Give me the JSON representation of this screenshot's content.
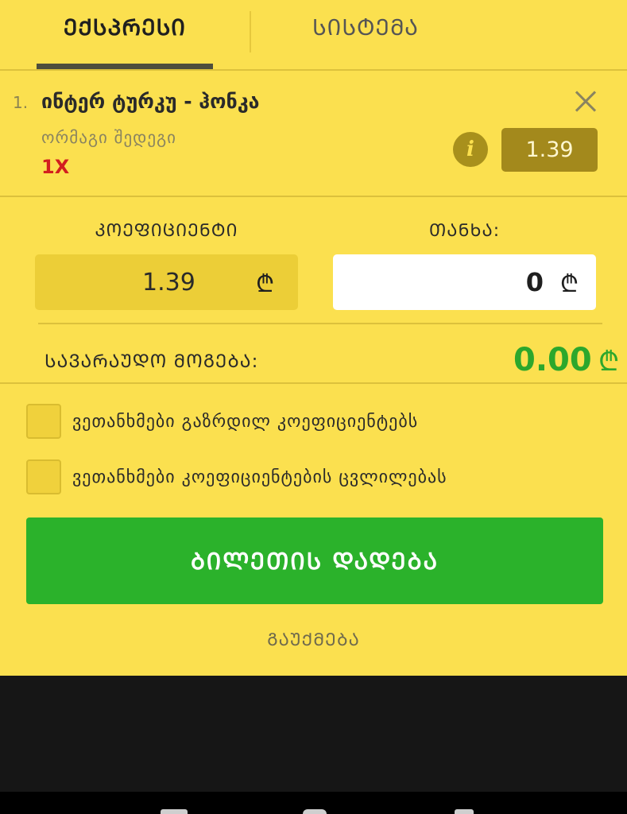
{
  "tabs": {
    "active": "ᲔᲥᲡᲞᲠᲔᲡᲘ",
    "inactive": "ᲡᲘᲡᲢᲔᲛᲐ"
  },
  "selection": {
    "index": "1.",
    "title": "ინტერ ტურკუ - ჰონკა",
    "market": "ორმაგი შედეგი",
    "pick": "1X",
    "odd": "1.39",
    "info_icon": "info-icon",
    "close_icon": "close-icon"
  },
  "bet": {
    "coef_label": "ᲙᲝᲔᲤᲘᲪᲘᲔᲜᲢᲘ",
    "stake_label": "ᲗᲐᲜᲮᲐ:",
    "coef_value": "1.39",
    "stake_value": "0",
    "currency_symbol": "₾"
  },
  "win": {
    "label": "ᲡᲐᲕᲐᲠᲐᲣᲓᲝ ᲛᲝᲒᲔᲑᲐ:",
    "value": "0.00",
    "currency_symbol": "₾"
  },
  "checkboxes": [
    {
      "label": "ვეთანხმები გაზრდილ კოეფიციენტებს",
      "checked": false
    },
    {
      "label": "ვეთანხმები კოეფიციენტების ცვლილებას",
      "checked": false
    }
  ],
  "actions": {
    "place_bet": "ᲑᲘᲚᲔᲗᲘᲡ ᲓᲐᲓᲔᲑᲐ",
    "cancel": "ᲒᲐᲣᲥᲛᲔᲑᲐ"
  },
  "colors": {
    "background": "#fbe04f",
    "odd_badge": "#a3891c",
    "pick": "#d21f1f",
    "win": "#2ca72c",
    "place_bet": "#2bb22b"
  }
}
